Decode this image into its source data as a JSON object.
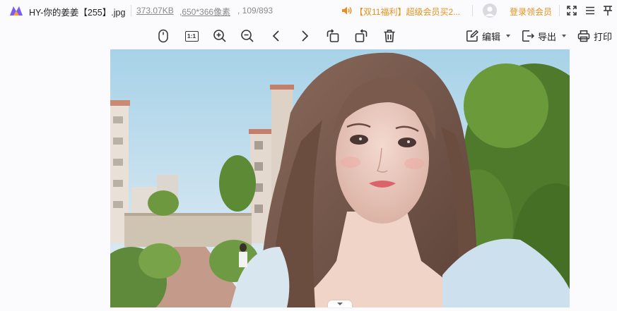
{
  "title_bar": {
    "file_name": "HY-你的姜姜【255】.jpg",
    "file_size": "373.07KB",
    "dimensions": ",650*366像素",
    "index": ", 109/893",
    "promo": "【双11福利】超级会员买2...",
    "login": "登录领会员",
    "icons": [
      "app-logo-icon",
      "speaker-icon",
      "avatar-icon",
      "fullscreen-icon",
      "menu-icon",
      "pin-icon"
    ],
    "accent_color": "#e8901a"
  },
  "toolbar": {
    "tools": [
      "mouse-icon",
      "actual-size-icon",
      "zoom-in-icon",
      "zoom-out-icon",
      "previous-icon",
      "next-icon",
      "rotate-left-icon",
      "rotate-right-icon",
      "delete-icon"
    ],
    "actual_size_label": "1:1",
    "edit_label": "编辑",
    "export_label": "导出",
    "print_label": "打印"
  },
  "image": {
    "description_icon": "photo",
    "collapse_icon": "chevron-down-icon"
  }
}
